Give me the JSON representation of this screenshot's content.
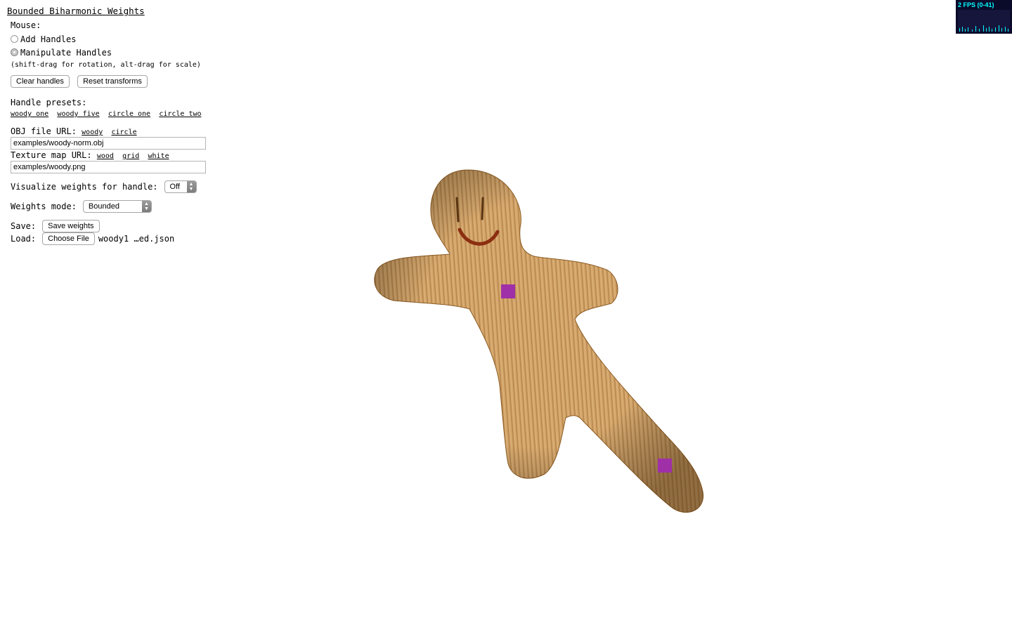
{
  "title": "Bounded Biharmonic Weights",
  "mouse_label": "Mouse:",
  "radio_add": "Add Handles",
  "radio_manipulate": "Manipulate Handles",
  "hint": "(shift-drag for rotation, alt-drag for scale)",
  "buttons": {
    "clear": "Clear handles",
    "reset": "Reset transforms"
  },
  "presets_label": "Handle presets:",
  "presets": [
    "woody one",
    "woody five",
    "circle one",
    "circle two"
  ],
  "obj_label": "OBJ file URL:",
  "obj_links": [
    "woody",
    "circle"
  ],
  "obj_value": "examples/woody-norm.obj",
  "texture_label": "Texture map URL:",
  "texture_links": [
    "wood",
    "grid",
    "white"
  ],
  "texture_value": "examples/woody.png",
  "visualize_label": "Visualize weights for handle:",
  "visualize_value": "Off",
  "weights_mode_label": "Weights mode:",
  "weights_mode_value": "Bounded",
  "save_label": "Save:",
  "save_button": "Save weights",
  "load_label": "Load:",
  "load_button": "Choose File",
  "load_filename": "woody1 …ed.json",
  "fps_text": "2 FPS (0-41)",
  "colors": {
    "handle": "#a030a8",
    "fps_bg": "#0a0a2a",
    "fps_text": "#00ffff",
    "wood": "#d2a66c"
  }
}
